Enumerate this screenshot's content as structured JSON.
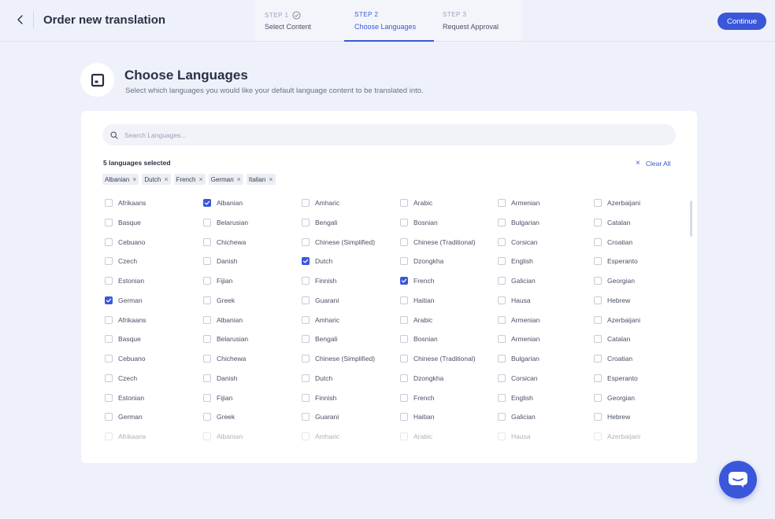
{
  "header": {
    "title": "Order new translation",
    "continue_label": "Continue",
    "steps": [
      {
        "num": "STEP 1",
        "label": "Select Content",
        "state": "complete"
      },
      {
        "num": "STEP 2",
        "label": "Choose Languages",
        "state": "active"
      },
      {
        "num": "STEP 3",
        "label": "Request Approval",
        "state": "upcoming"
      }
    ]
  },
  "heading": {
    "title": "Choose Languages",
    "subtitle": "Select which languages you would like your default language content to be translated into."
  },
  "search": {
    "placeholder": "Search Languages..."
  },
  "selection": {
    "count_text": "5 languages selected",
    "clear_label": "Clear All",
    "chips": [
      "Albanian",
      "Dutch",
      "French",
      "German",
      "Italian"
    ]
  },
  "languages": [
    [
      "Afrikaans",
      "Albanian",
      "Amharic",
      "Arabic",
      "Armenian",
      "Azerbaijani"
    ],
    [
      "Basque",
      "Belarusian",
      "Bengali",
      "Bosnian",
      "Bulgarian",
      "Catalan"
    ],
    [
      "Cebuano",
      "Chichewa",
      "Chinese (Simplified)",
      "Chinese (Traditional)",
      "Corsican",
      "Croatian"
    ],
    [
      "Czech",
      "Danish",
      "Dutch",
      "Dzongkha",
      "English",
      "Esperanto"
    ],
    [
      "Estonian",
      "Fijian",
      "Finnish",
      "French",
      "Galician",
      "Georgian"
    ],
    [
      "German",
      "Greek",
      "Guarani",
      "Haitian",
      "Hausa",
      "Hebrew"
    ],
    [
      "Afrikaans",
      "Albanian",
      "Amharic",
      "Arabic",
      "Armenian",
      "Azerbaijani"
    ],
    [
      "Basque",
      "Belarusian",
      "Bengali",
      "Bosnian",
      "Armenian",
      "Catalan"
    ],
    [
      "Cebuano",
      "Chichewa",
      "Chinese (Simplified)",
      "Chinese (Traditional)",
      "Bulgarian",
      "Croatian"
    ],
    [
      "Czech",
      "Danish",
      "Dutch",
      "Dzongkha",
      "Corsican",
      "Esperanto"
    ],
    [
      "Estonian",
      "Fijian",
      "Finnish",
      "French",
      "English",
      "Georgian"
    ],
    [
      "German",
      "Greek",
      "Guarani",
      "Haitian",
      "Galician",
      "Hebrew"
    ],
    [
      "Afrikaans",
      "Albanian",
      "Amharic",
      "Arabic",
      "Hausa",
      "Azerbaijani"
    ]
  ],
  "checked": [
    [
      0,
      1
    ],
    [
      3,
      2
    ],
    [
      4,
      3
    ],
    [
      5,
      0
    ]
  ],
  "faded_rows": [
    12
  ],
  "colors": {
    "accent": "#3b57d9",
    "background": "#eef1fa"
  },
  "icons": {
    "back": "chevron-left-icon",
    "search": "search-icon",
    "chat": "chat-icon",
    "heading": "language-box-icon"
  }
}
